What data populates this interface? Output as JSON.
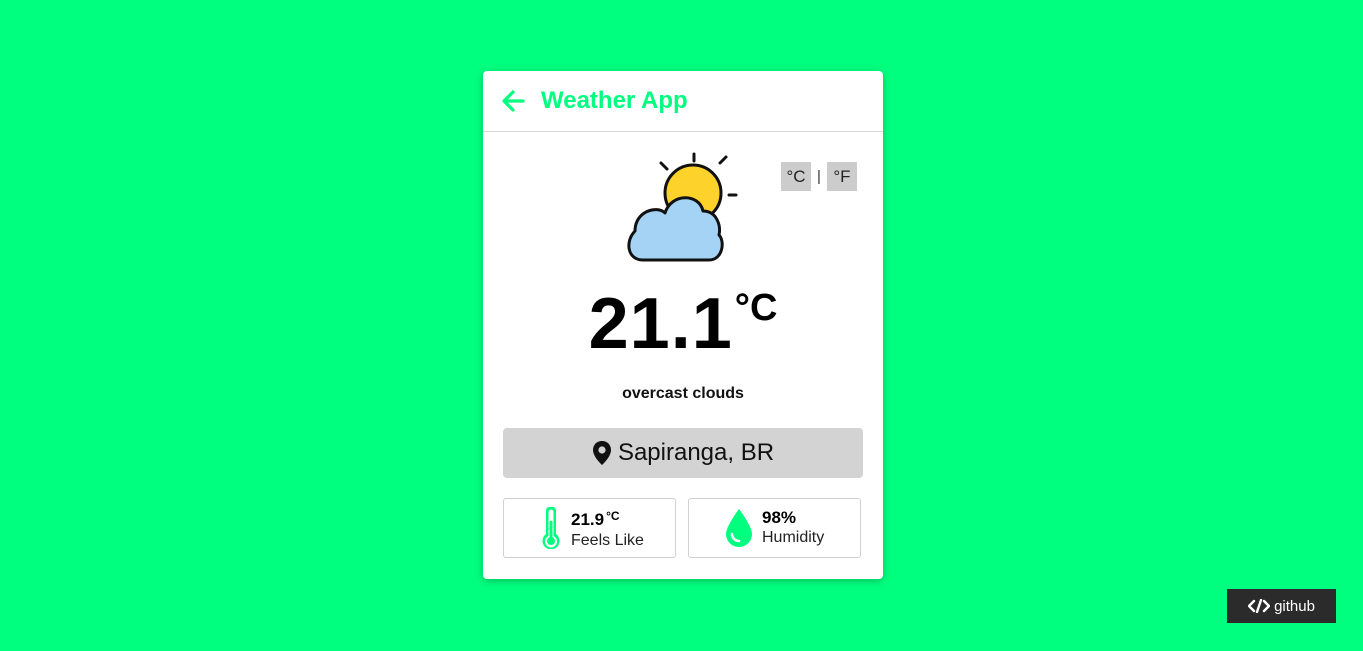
{
  "header": {
    "title": "Weather App"
  },
  "units": {
    "celsius": "°C",
    "separator": "|",
    "fahrenheit": "°F"
  },
  "current": {
    "temperature": "21.1",
    "unit": "°C",
    "description": "overcast clouds",
    "icon": "partly-cloudy-icon"
  },
  "location": {
    "name": "Sapiranga, BR"
  },
  "stats": {
    "feels_like": {
      "value": "21.9",
      "unit": "°C",
      "label": "Feels Like"
    },
    "humidity": {
      "value": "98%",
      "label": "Humidity"
    }
  },
  "footer": {
    "github_label": "github"
  },
  "colors": {
    "accent": "#00ff7f",
    "background": "#00ff7f",
    "sun": "#fdd22b",
    "cloud": "#a5d3f5"
  }
}
